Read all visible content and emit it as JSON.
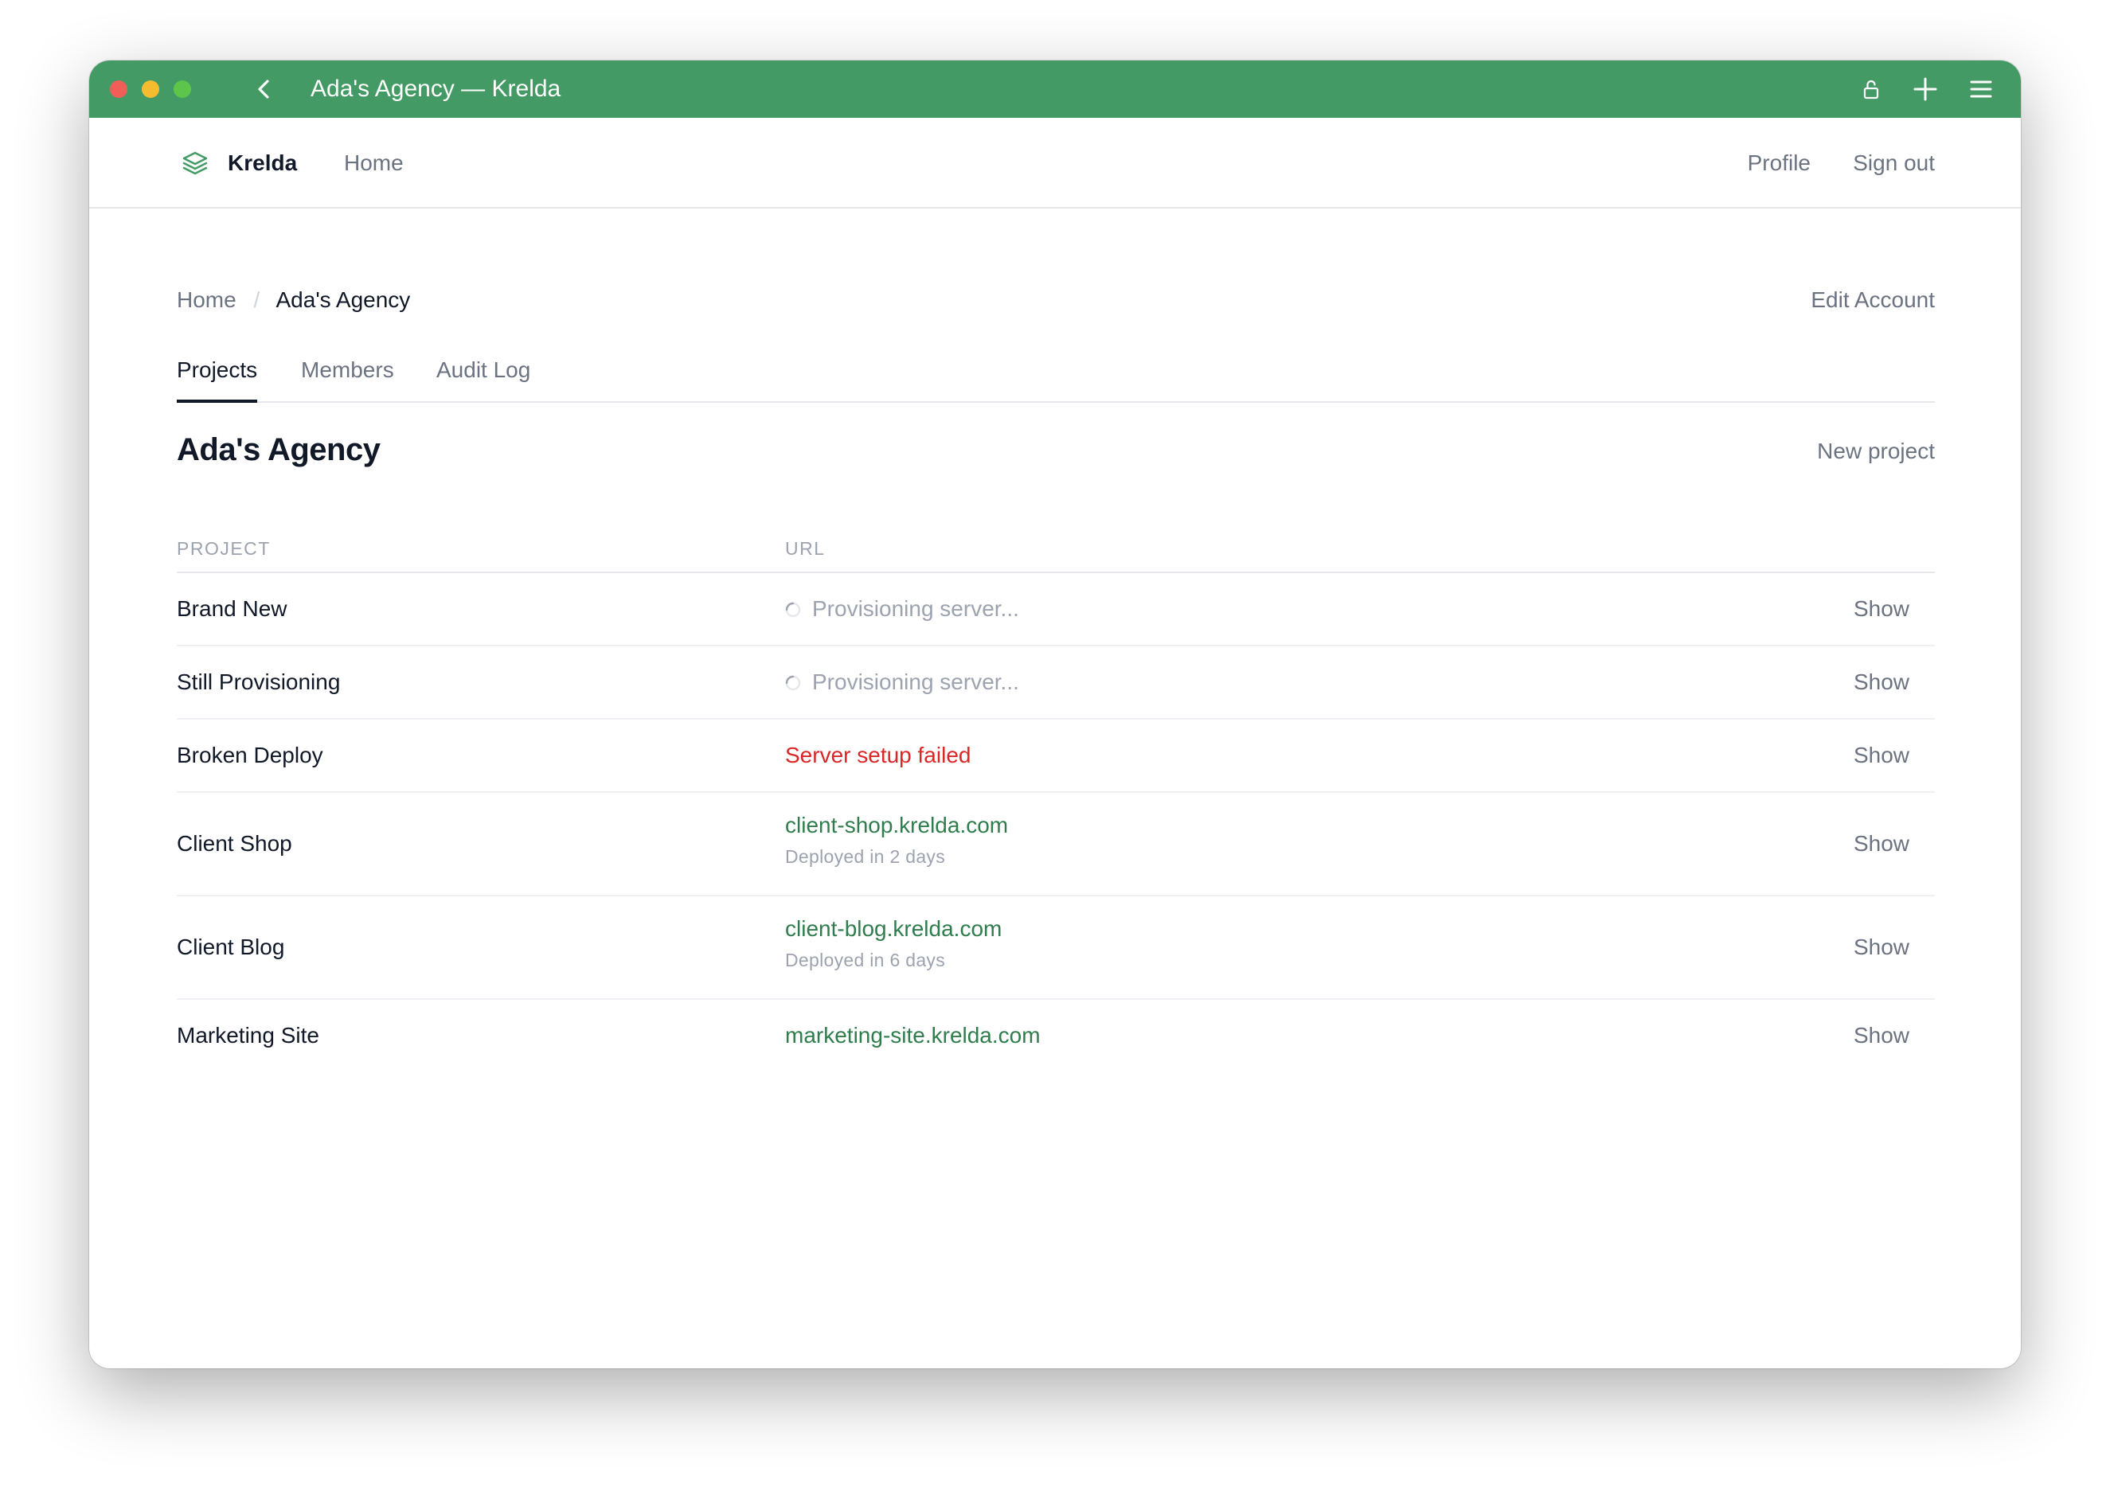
{
  "window": {
    "title": "Ada's Agency — Krelda",
    "colors": {
      "titlebar": "#439a64",
      "link_green": "#2f7d4c",
      "error_red": "#dc2626"
    }
  },
  "navbar": {
    "brand": "Krelda",
    "home": "Home",
    "profile": "Profile",
    "sign_out": "Sign out"
  },
  "breadcrumb": {
    "home": "Home",
    "separator": "/",
    "current": "Ada's Agency"
  },
  "edit_account": "Edit Account",
  "tabs": [
    {
      "label": "Projects",
      "active": true
    },
    {
      "label": "Members",
      "active": false
    },
    {
      "label": "Audit Log",
      "active": false
    }
  ],
  "page_title": "Ada's Agency",
  "new_project": "New project",
  "table": {
    "headers": {
      "project": "PROJECT",
      "url": "URL"
    },
    "rows": [
      {
        "name": "Brand New",
        "status": "pending",
        "url": "Provisioning server...",
        "deployed": "",
        "action": "Show"
      },
      {
        "name": "Still Provisioning",
        "status": "pending",
        "url": "Provisioning server...",
        "deployed": "",
        "action": "Show"
      },
      {
        "name": "Broken Deploy",
        "status": "error",
        "url": "Server setup failed",
        "deployed": "",
        "action": "Show"
      },
      {
        "name": "Client Shop",
        "status": "live",
        "url": "client-shop.krelda.com",
        "deployed": "Deployed in 2 days",
        "action": "Show"
      },
      {
        "name": "Client Blog",
        "status": "live",
        "url": "client-blog.krelda.com",
        "deployed": "Deployed in 6 days",
        "action": "Show"
      },
      {
        "name": "Marketing Site",
        "status": "live",
        "url": "marketing-site.krelda.com",
        "deployed": "",
        "action": "Show"
      }
    ]
  }
}
